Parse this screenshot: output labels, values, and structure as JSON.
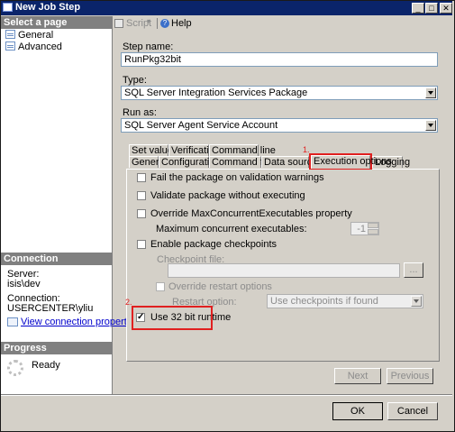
{
  "window": {
    "title": "New Job Step"
  },
  "title_buttons": {
    "minimize": "_",
    "maximize": "□",
    "close": "✕"
  },
  "left": {
    "select_page_header": "Select a page",
    "pages": [
      {
        "label": "General"
      },
      {
        "label": "Advanced"
      }
    ],
    "connection_header": "Connection",
    "server_label": "Server:",
    "server_value": "isis\\dev",
    "connection_label": "Connection:",
    "connection_value": "USERCENTER\\yliu",
    "view_connection": "View connection properties",
    "progress_header": "Progress",
    "progress_status": "Ready"
  },
  "toolbar": {
    "script_label": "Script",
    "help_label": "Help"
  },
  "form": {
    "step_name_label": "Step name:",
    "step_name_value": "RunPkg32bit",
    "type_label": "Type:",
    "type_value": "SQL Server Integration Services Package",
    "run_as_label": "Run as:",
    "run_as_value": "SQL Server Agent Service Account"
  },
  "tabs": {
    "row1": [
      "Set values",
      "Verification",
      "Command line"
    ],
    "row2": [
      "General",
      "Configurations",
      "Command files",
      "Data sources",
      "Execution options",
      "Logging"
    ],
    "active": "Execution options"
  },
  "options": {
    "fail_on_warnings": "Fail the package on validation warnings",
    "validate_without_exec": "Validate package without executing",
    "override_max": "Override MaxConcurrentExecutables property",
    "max_concurrent_label": "Maximum concurrent executables:",
    "max_concurrent_value": "-1",
    "enable_checkpoints": "Enable package checkpoints",
    "checkpoint_file_label": "Checkpoint file:",
    "browse_label": "...",
    "override_restart": "Override restart options",
    "restart_option_label": "Restart option:",
    "restart_option_value": "Use checkpoints if found",
    "use_32bit": "Use 32 bit runtime",
    "use_32bit_checked": true
  },
  "annotations": {
    "marker_1": "1.",
    "marker_2": "2."
  },
  "buttons": {
    "next": "Next",
    "previous": "Previous",
    "ok": "OK",
    "cancel": "Cancel"
  }
}
